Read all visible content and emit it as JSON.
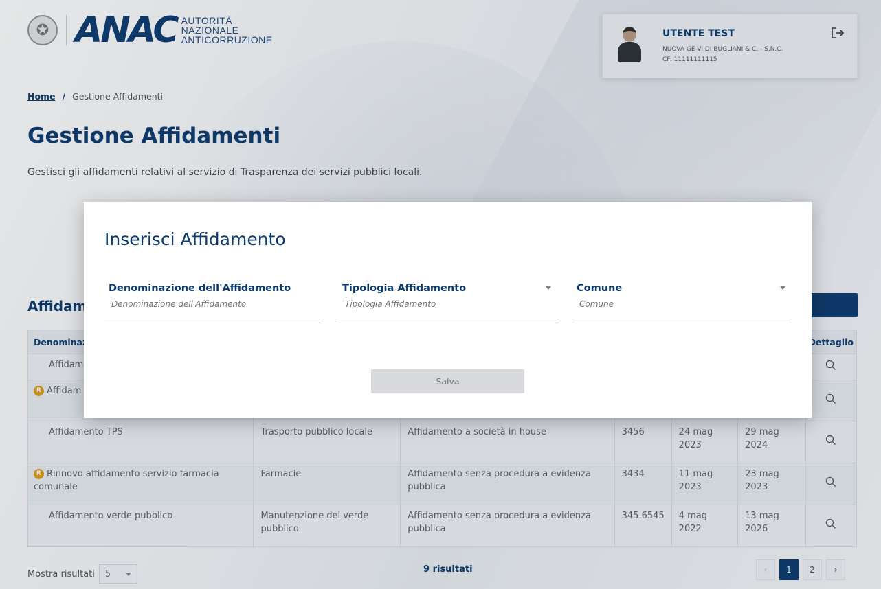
{
  "header": {
    "logo_text_line1": "AUTORITÀ",
    "logo_text_line2": "NAZIONALE",
    "logo_text_line3": "ANTICORRUZIONE",
    "logo_mark": "ANAC",
    "user_name": "UTENTE TEST",
    "user_company": "NUOVA GE-VI DI BUGLIANI & C. - S.N.C.",
    "user_cf": "CF: 11111111115",
    "icons": {
      "logout": "logout-icon",
      "emblem": "emblem-icon",
      "avatar": "avatar-icon"
    }
  },
  "breadcrumb": {
    "home": "Home",
    "separator": "/",
    "current": "Gestione Affidamenti"
  },
  "page": {
    "title": "Gestione Affidamenti",
    "subtitle": "Gestisci gli affidamenti relativi al servizio di Trasparenza dei servizi pubblici locali.",
    "section_title": "Affidame"
  },
  "table": {
    "headers": {
      "denominazione": "Denominaz",
      "dettaglio": "Dettaglio"
    },
    "rows": [
      {
        "badge": "",
        "denominazione": "Affidam",
        "tipologia": "",
        "modalita": "",
        "codice": "",
        "data_inizio": "",
        "data_fine": ""
      },
      {
        "badge": "R",
        "denominazione": "Affidam",
        "tipologia": "",
        "modalita": "",
        "codice": "",
        "data_inizio": "",
        "data_fine": ""
      },
      {
        "badge": "",
        "denominazione": "Affidamento TPS",
        "tipologia": "Trasporto pubblico locale",
        "modalita": "Affidamento a società in house",
        "codice": "3456",
        "data_inizio": "24 mag 2023",
        "data_fine": "29 mag 2024"
      },
      {
        "badge": "R",
        "denominazione": "Rinnovo affidamento servizio farmacia comunale",
        "tipologia": "Farmacie",
        "modalita": "Affidamento senza procedura a evidenza pubblica",
        "codice": "3434",
        "data_inizio": "11 mag 2023",
        "data_fine": "23 mag 2023"
      },
      {
        "badge": "",
        "denominazione": "Affidamento verde pubblico",
        "tipologia": "Manutenzione del verde pubblico",
        "modalita": "Affidamento senza procedura a evidenza pubblica",
        "codice": "345.6545",
        "data_inizio": "4 mag 2022",
        "data_fine": "13 mag 2026"
      }
    ]
  },
  "footer": {
    "show_results_label": "Mostra risultati",
    "page_size": "5",
    "results_count": "9 risultati",
    "pages": [
      "1",
      "2"
    ],
    "prev": "‹",
    "next": "›"
  },
  "modal": {
    "title": "Inserisci Affidamento",
    "fields": {
      "denominazione": {
        "label": "Denominazione dell'Affidamento",
        "placeholder": "Denominazione dell'Affidamento"
      },
      "tipologia": {
        "label": "Tipologia Affidamento",
        "placeholder": "Tipologia Affidamento"
      },
      "comune": {
        "label": "Comune",
        "placeholder": "Comune"
      }
    },
    "save_label": "Salva"
  },
  "colors": {
    "primary": "#0b3a6e",
    "badge": "#d99a1a",
    "save_disabled": "#d8dadd"
  }
}
